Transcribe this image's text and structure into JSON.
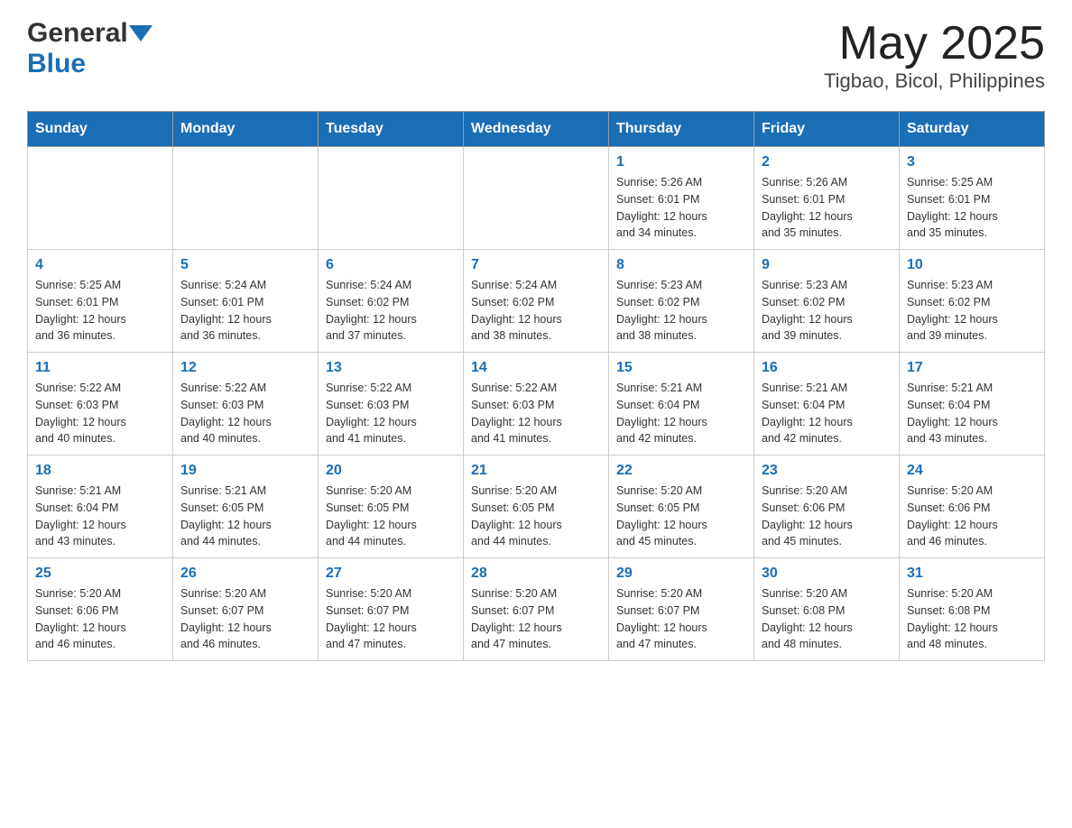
{
  "header": {
    "logo_general": "General",
    "logo_blue": "Blue",
    "title": "May 2025",
    "subtitle": "Tigbao, Bicol, Philippines"
  },
  "calendar": {
    "days_of_week": [
      "Sunday",
      "Monday",
      "Tuesday",
      "Wednesday",
      "Thursday",
      "Friday",
      "Saturday"
    ],
    "weeks": [
      [
        {
          "day": "",
          "info": ""
        },
        {
          "day": "",
          "info": ""
        },
        {
          "day": "",
          "info": ""
        },
        {
          "day": "",
          "info": ""
        },
        {
          "day": "1",
          "info": "Sunrise: 5:26 AM\nSunset: 6:01 PM\nDaylight: 12 hours\nand 34 minutes."
        },
        {
          "day": "2",
          "info": "Sunrise: 5:26 AM\nSunset: 6:01 PM\nDaylight: 12 hours\nand 35 minutes."
        },
        {
          "day": "3",
          "info": "Sunrise: 5:25 AM\nSunset: 6:01 PM\nDaylight: 12 hours\nand 35 minutes."
        }
      ],
      [
        {
          "day": "4",
          "info": "Sunrise: 5:25 AM\nSunset: 6:01 PM\nDaylight: 12 hours\nand 36 minutes."
        },
        {
          "day": "5",
          "info": "Sunrise: 5:24 AM\nSunset: 6:01 PM\nDaylight: 12 hours\nand 36 minutes."
        },
        {
          "day": "6",
          "info": "Sunrise: 5:24 AM\nSunset: 6:02 PM\nDaylight: 12 hours\nand 37 minutes."
        },
        {
          "day": "7",
          "info": "Sunrise: 5:24 AM\nSunset: 6:02 PM\nDaylight: 12 hours\nand 38 minutes."
        },
        {
          "day": "8",
          "info": "Sunrise: 5:23 AM\nSunset: 6:02 PM\nDaylight: 12 hours\nand 38 minutes."
        },
        {
          "day": "9",
          "info": "Sunrise: 5:23 AM\nSunset: 6:02 PM\nDaylight: 12 hours\nand 39 minutes."
        },
        {
          "day": "10",
          "info": "Sunrise: 5:23 AM\nSunset: 6:02 PM\nDaylight: 12 hours\nand 39 minutes."
        }
      ],
      [
        {
          "day": "11",
          "info": "Sunrise: 5:22 AM\nSunset: 6:03 PM\nDaylight: 12 hours\nand 40 minutes."
        },
        {
          "day": "12",
          "info": "Sunrise: 5:22 AM\nSunset: 6:03 PM\nDaylight: 12 hours\nand 40 minutes."
        },
        {
          "day": "13",
          "info": "Sunrise: 5:22 AM\nSunset: 6:03 PM\nDaylight: 12 hours\nand 41 minutes."
        },
        {
          "day": "14",
          "info": "Sunrise: 5:22 AM\nSunset: 6:03 PM\nDaylight: 12 hours\nand 41 minutes."
        },
        {
          "day": "15",
          "info": "Sunrise: 5:21 AM\nSunset: 6:04 PM\nDaylight: 12 hours\nand 42 minutes."
        },
        {
          "day": "16",
          "info": "Sunrise: 5:21 AM\nSunset: 6:04 PM\nDaylight: 12 hours\nand 42 minutes."
        },
        {
          "day": "17",
          "info": "Sunrise: 5:21 AM\nSunset: 6:04 PM\nDaylight: 12 hours\nand 43 minutes."
        }
      ],
      [
        {
          "day": "18",
          "info": "Sunrise: 5:21 AM\nSunset: 6:04 PM\nDaylight: 12 hours\nand 43 minutes."
        },
        {
          "day": "19",
          "info": "Sunrise: 5:21 AM\nSunset: 6:05 PM\nDaylight: 12 hours\nand 44 minutes."
        },
        {
          "day": "20",
          "info": "Sunrise: 5:20 AM\nSunset: 6:05 PM\nDaylight: 12 hours\nand 44 minutes."
        },
        {
          "day": "21",
          "info": "Sunrise: 5:20 AM\nSunset: 6:05 PM\nDaylight: 12 hours\nand 44 minutes."
        },
        {
          "day": "22",
          "info": "Sunrise: 5:20 AM\nSunset: 6:05 PM\nDaylight: 12 hours\nand 45 minutes."
        },
        {
          "day": "23",
          "info": "Sunrise: 5:20 AM\nSunset: 6:06 PM\nDaylight: 12 hours\nand 45 minutes."
        },
        {
          "day": "24",
          "info": "Sunrise: 5:20 AM\nSunset: 6:06 PM\nDaylight: 12 hours\nand 46 minutes."
        }
      ],
      [
        {
          "day": "25",
          "info": "Sunrise: 5:20 AM\nSunset: 6:06 PM\nDaylight: 12 hours\nand 46 minutes."
        },
        {
          "day": "26",
          "info": "Sunrise: 5:20 AM\nSunset: 6:07 PM\nDaylight: 12 hours\nand 46 minutes."
        },
        {
          "day": "27",
          "info": "Sunrise: 5:20 AM\nSunset: 6:07 PM\nDaylight: 12 hours\nand 47 minutes."
        },
        {
          "day": "28",
          "info": "Sunrise: 5:20 AM\nSunset: 6:07 PM\nDaylight: 12 hours\nand 47 minutes."
        },
        {
          "day": "29",
          "info": "Sunrise: 5:20 AM\nSunset: 6:07 PM\nDaylight: 12 hours\nand 47 minutes."
        },
        {
          "day": "30",
          "info": "Sunrise: 5:20 AM\nSunset: 6:08 PM\nDaylight: 12 hours\nand 48 minutes."
        },
        {
          "day": "31",
          "info": "Sunrise: 5:20 AM\nSunset: 6:08 PM\nDaylight: 12 hours\nand 48 minutes."
        }
      ]
    ]
  }
}
